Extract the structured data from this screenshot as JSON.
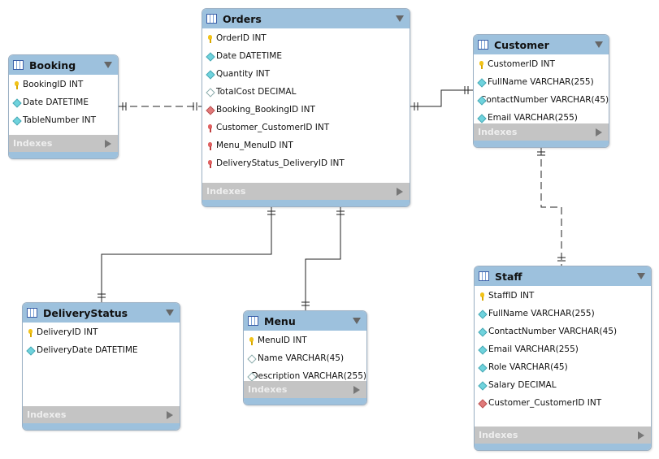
{
  "indexes_label": "Indexes",
  "tables": {
    "booking": {
      "name": "Booking",
      "columns": [
        {
          "icon": "key",
          "text": "BookingID INT"
        },
        {
          "icon": "dia",
          "text": "Date DATETIME"
        },
        {
          "icon": "dia",
          "text": "TableNumber INT"
        }
      ]
    },
    "orders": {
      "name": "Orders",
      "columns": [
        {
          "icon": "key",
          "text": "OrderID INT"
        },
        {
          "icon": "dia",
          "text": "Date DATETIME"
        },
        {
          "icon": "dia",
          "text": "Quantity INT"
        },
        {
          "icon": "hol",
          "text": "TotalCost DECIMAL"
        },
        {
          "icon": "red",
          "text": "Booking_BookingID INT"
        },
        {
          "icon": "rkey",
          "text": "Customer_CustomerID INT"
        },
        {
          "icon": "rkey",
          "text": "Menu_MenuID INT"
        },
        {
          "icon": "rkey",
          "text": "DeliveryStatus_DeliveryID INT"
        }
      ]
    },
    "customer": {
      "name": "Customer",
      "columns": [
        {
          "icon": "key",
          "text": "CustomerID INT"
        },
        {
          "icon": "dia",
          "text": "FullName VARCHAR(255)"
        },
        {
          "icon": "dia",
          "text": "ContactNumber VARCHAR(45)"
        },
        {
          "icon": "dia",
          "text": "Email VARCHAR(255)"
        }
      ]
    },
    "staff": {
      "name": "Staff",
      "columns": [
        {
          "icon": "key",
          "text": "StaffID INT"
        },
        {
          "icon": "dia",
          "text": "FullName VARCHAR(255)"
        },
        {
          "icon": "dia",
          "text": "ContactNumber VARCHAR(45)"
        },
        {
          "icon": "dia",
          "text": "Email VARCHAR(255)"
        },
        {
          "icon": "dia",
          "text": "Role VARCHAR(45)"
        },
        {
          "icon": "dia",
          "text": "Salary DECIMAL"
        },
        {
          "icon": "red",
          "text": "Customer_CustomerID INT"
        }
      ]
    },
    "deliverystatus": {
      "name": "DeliveryStatus",
      "columns": [
        {
          "icon": "key",
          "text": "DeliveryID INT"
        },
        {
          "icon": "dia",
          "text": "DeliveryDate DATETIME"
        }
      ]
    },
    "menu": {
      "name": "Menu",
      "columns": [
        {
          "icon": "key",
          "text": "MenuID INT"
        },
        {
          "icon": "hol",
          "text": "Name VARCHAR(45)"
        },
        {
          "icon": "hol",
          "text": "Description VARCHAR(255)"
        }
      ]
    }
  }
}
